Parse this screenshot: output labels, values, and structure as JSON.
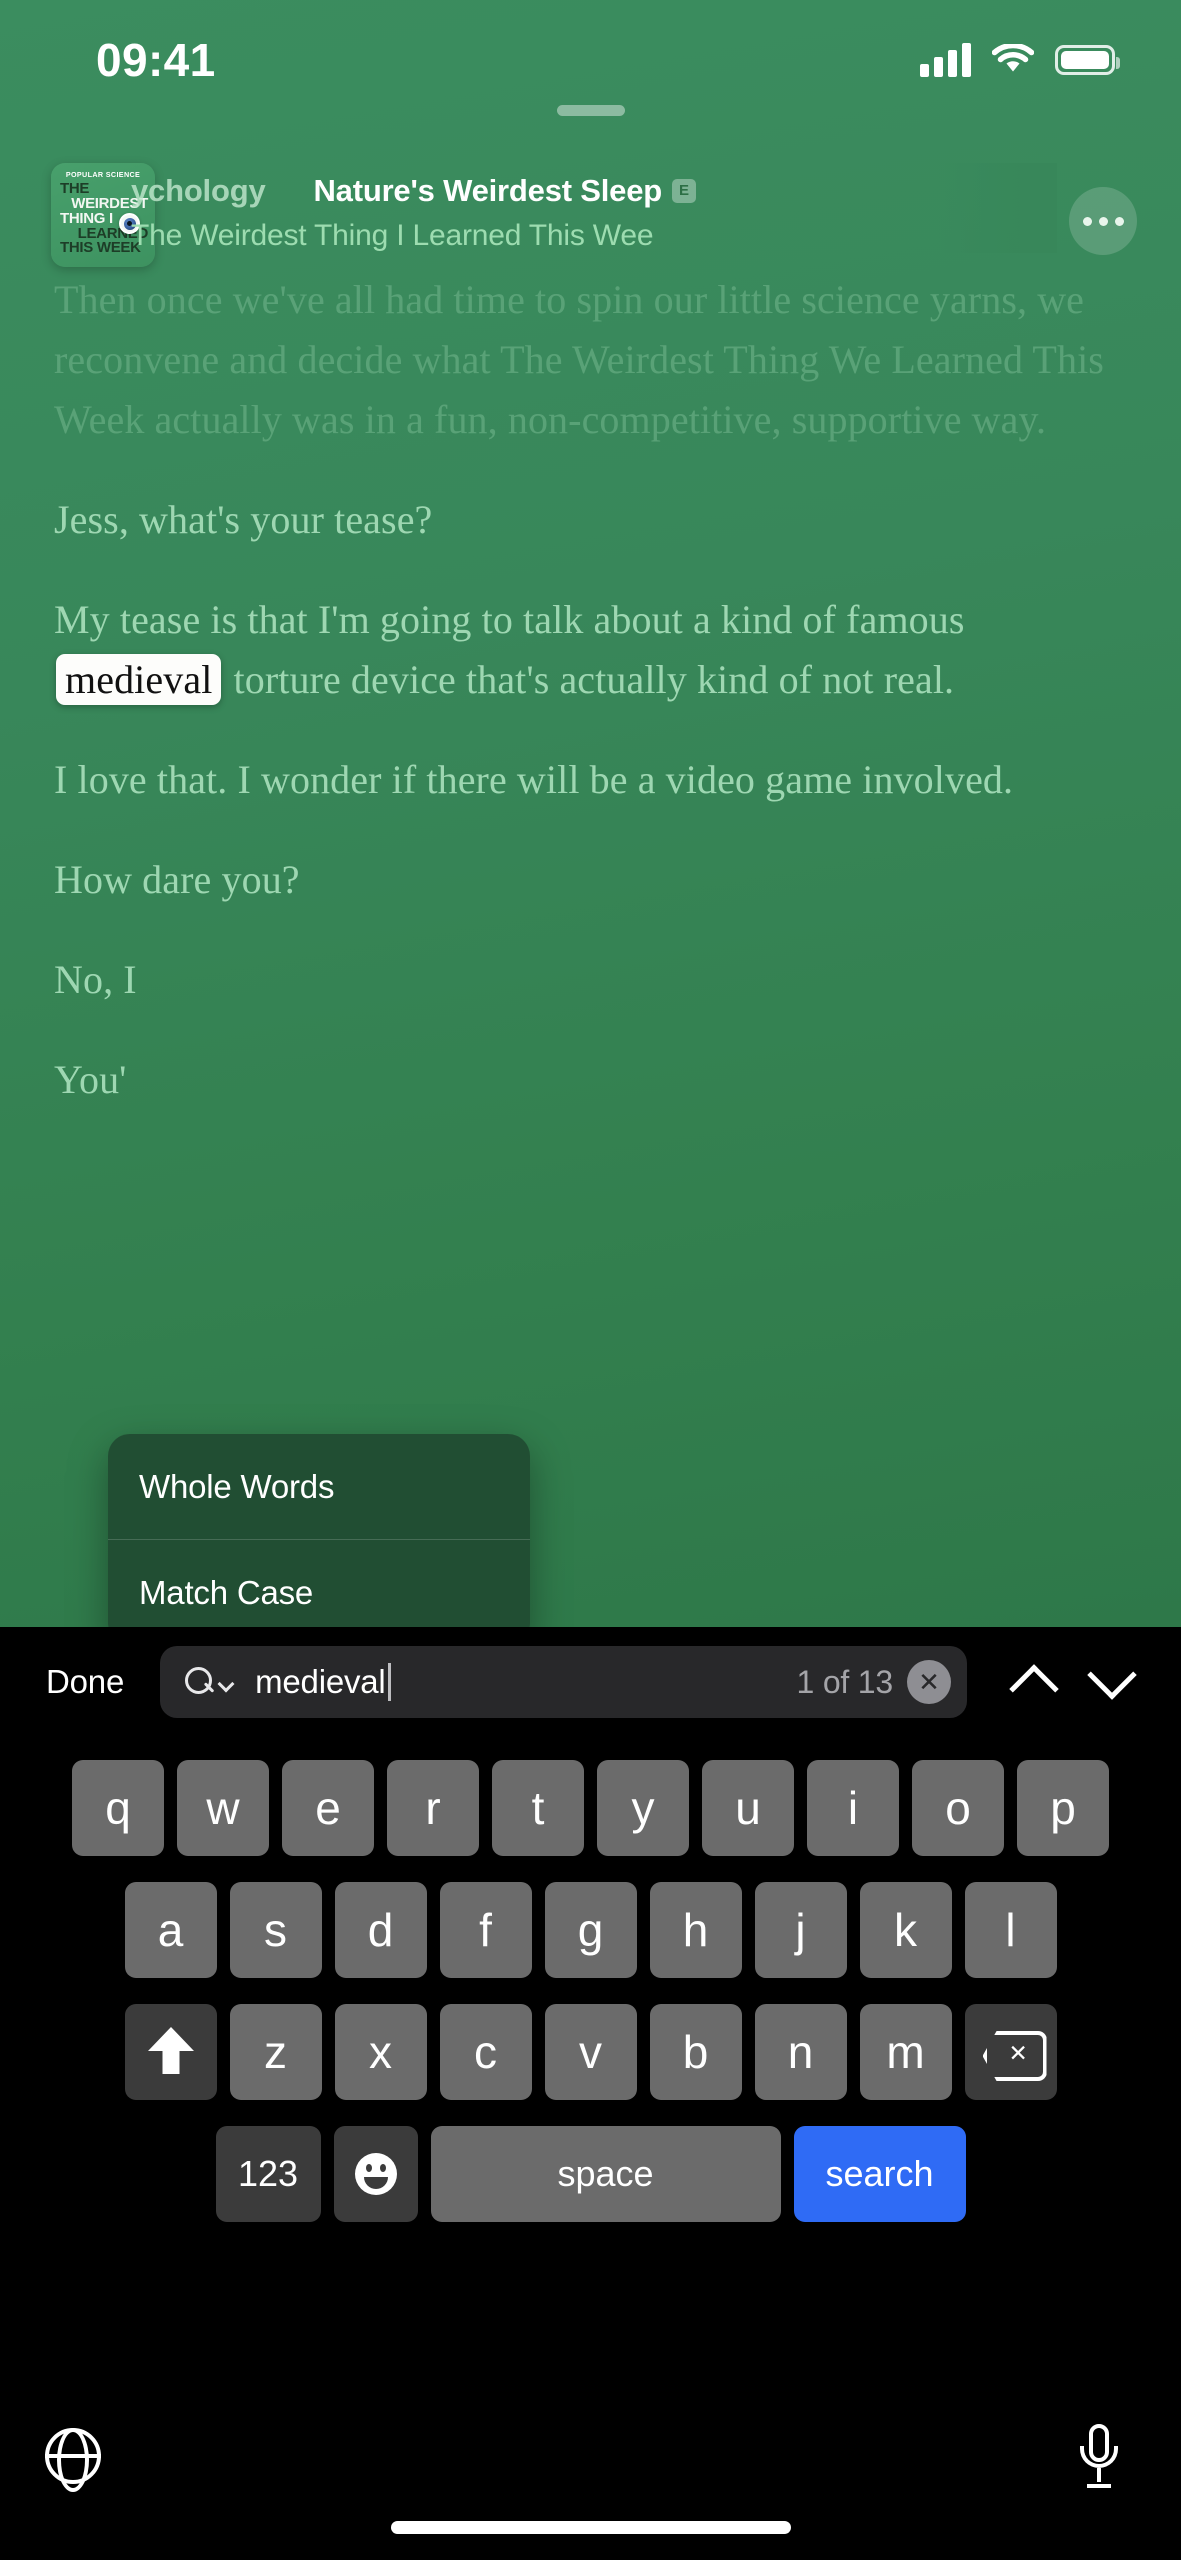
{
  "status_bar": {
    "time": "09:41",
    "cellular_icon": "cellular-bars-icon",
    "wifi_icon": "wifi-icon",
    "battery_icon": "battery-full-icon"
  },
  "header": {
    "artwork": {
      "kicker": "POPULAR SCIENCE",
      "line1": "THE",
      "line2": "WEIRDEST",
      "line3": "THING I",
      "line4": "LEARNED",
      "line5": "THIS WEEK"
    },
    "episode_prev_fragment": "ychology",
    "episode_title": "Nature's Weirdest Sleep",
    "explicit_badge": "E",
    "show_name": "The Weirdest Thing I Learned This Wee",
    "more_button_label": "more-options"
  },
  "transcript": {
    "paragraphs": [
      {
        "text": "Then once we've all had time to spin our little science yarns, we reconvene and decide what The Weirdest Thing We Learned This Week actually was in a fun, non-competitive, supportive way."
      },
      {
        "text": "Jess, what's your tease?"
      },
      {
        "pre": "My tease is that I'm going to talk about a kind of famous ",
        "highlight": "medieval",
        "post": " torture device that's actually kind of not real."
      },
      {
        "text": "I love that. I wonder if there will be a video game involved."
      },
      {
        "text": "How dare you?"
      },
      {
        "text": "No, I"
      },
      {
        "text": "You'"
      }
    ]
  },
  "context_menu": {
    "items": [
      {
        "label": "Whole Words"
      },
      {
        "label": "Match Case"
      }
    ]
  },
  "find_bar": {
    "done_label": "Done",
    "search_icon": "magnifier-with-chevron-icon",
    "query": "medieval",
    "hit_count": "1 of 13",
    "clear_icon": "clear-x-icon",
    "prev_icon": "chevron-up-icon",
    "next_icon": "chevron-down-icon"
  },
  "keyboard": {
    "row1": [
      "q",
      "w",
      "e",
      "r",
      "t",
      "y",
      "u",
      "i",
      "o",
      "p"
    ],
    "row2": [
      "a",
      "s",
      "d",
      "f",
      "g",
      "h",
      "j",
      "k",
      "l"
    ],
    "row3": [
      "z",
      "x",
      "c",
      "v",
      "b",
      "n",
      "m"
    ],
    "shift_icon": "shift-arrow-icon",
    "delete_icon": "backspace-icon",
    "numbers_label": "123",
    "emoji_icon": "emoji-smiley-icon",
    "space_label": "space",
    "return_label": "search",
    "globe_icon": "globe-icon",
    "mic_icon": "microphone-icon"
  },
  "colors": {
    "background_green": "#38875a",
    "accent_blue": "#2f6bf5",
    "highlight_white": "#fdfdfb",
    "transcript_text": "#9ed7b2",
    "keyboard_key": "#6b6b6b",
    "keyboard_fn_key": "#3b3b3b"
  }
}
